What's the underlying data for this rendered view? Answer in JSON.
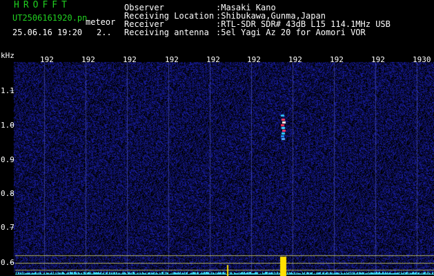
{
  "header": {
    "app_title": "HROFFT",
    "filename": "UT2506161920.pn",
    "mode": "meteor",
    "datetime": "25.06.16 19:20",
    "extra": "2..",
    "fields": [
      {
        "label": "Observer",
        "value": ":Masaki Kano"
      },
      {
        "label": "Receiving Location",
        "value": ":Shibukawa,Gunma,Japan"
      },
      {
        "label": "Receiver",
        "value": ":RTL-SDR SDR# 43dB L15 114.1MHz USB"
      },
      {
        "label": "Receiving antenna",
        "value": ":5el Yagi Az 20 for Aomori VOR"
      }
    ]
  },
  "axis": {
    "unit": "kHz",
    "y_ticks": [
      "1.1",
      "1.0",
      "0.9",
      "0.8",
      "0.7",
      "0.6"
    ],
    "x_ticks": [
      "192",
      "192",
      "192",
      "192",
      "192",
      "192",
      "192",
      "192",
      "192",
      "1930"
    ]
  },
  "colors": {
    "background": "#000000",
    "header_text": "#ffffff",
    "title_green": "#20d020",
    "waterfall_blue": "#0e1c9c",
    "spectrum_cyan": "#40e0ff",
    "meteor_yellow": "#ffe000",
    "guide_lines": "#b0b060"
  }
}
